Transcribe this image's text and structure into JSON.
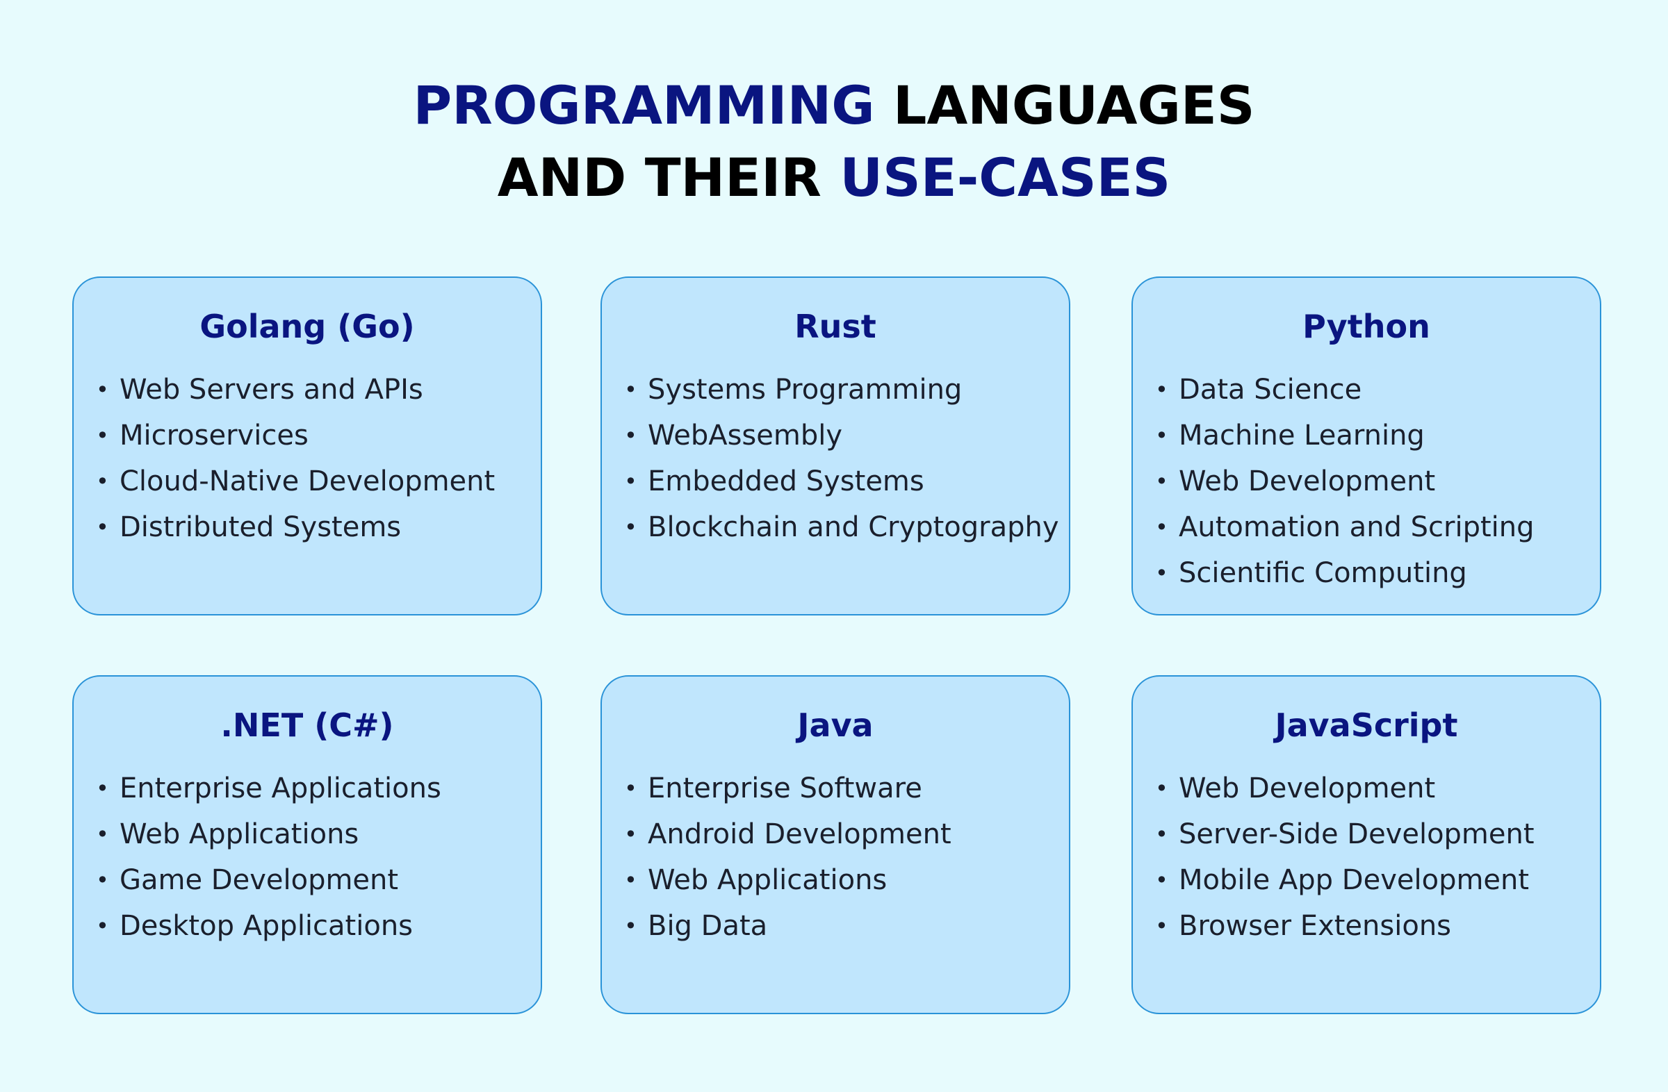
{
  "title": {
    "line1_accent": "PROGRAMMING",
    "line1_plain": " LANGUAGES",
    "line2_plain": "AND THEIR ",
    "line2_accent": "USE-CASES"
  },
  "colors": {
    "background": "#e7fbfd",
    "card_fill": "#c0e6fd",
    "card_border": "#2a93d8",
    "accent": "#0a1580",
    "text": "#1a1f2c"
  },
  "bullet_icon": "•",
  "cards": [
    {
      "title": "Golang (Go)",
      "items": [
        "Web Servers and APIs",
        "Microservices",
        "Cloud-Native Development",
        "Distributed Systems"
      ]
    },
    {
      "title": "Rust",
      "items": [
        "Systems Programming",
        "WebAssembly",
        "Embedded Systems",
        "Blockchain and Cryptography"
      ]
    },
    {
      "title": "Python",
      "items": [
        "Data Science",
        "Machine Learning",
        "Web Development",
        "Automation and Scripting",
        "Scientific Computing"
      ]
    },
    {
      "title": ".NET (C#)",
      "items": [
        "Enterprise Applications",
        "Web Applications",
        "Game Development",
        "Desktop Applications"
      ]
    },
    {
      "title": "Java",
      "items": [
        "Enterprise Software",
        "Android Development",
        "Web Applications",
        "Big Data"
      ]
    },
    {
      "title": "JavaScript",
      "items": [
        "Web Development",
        "Server-Side Development",
        "Mobile App Development",
        "Browser Extensions"
      ]
    }
  ]
}
